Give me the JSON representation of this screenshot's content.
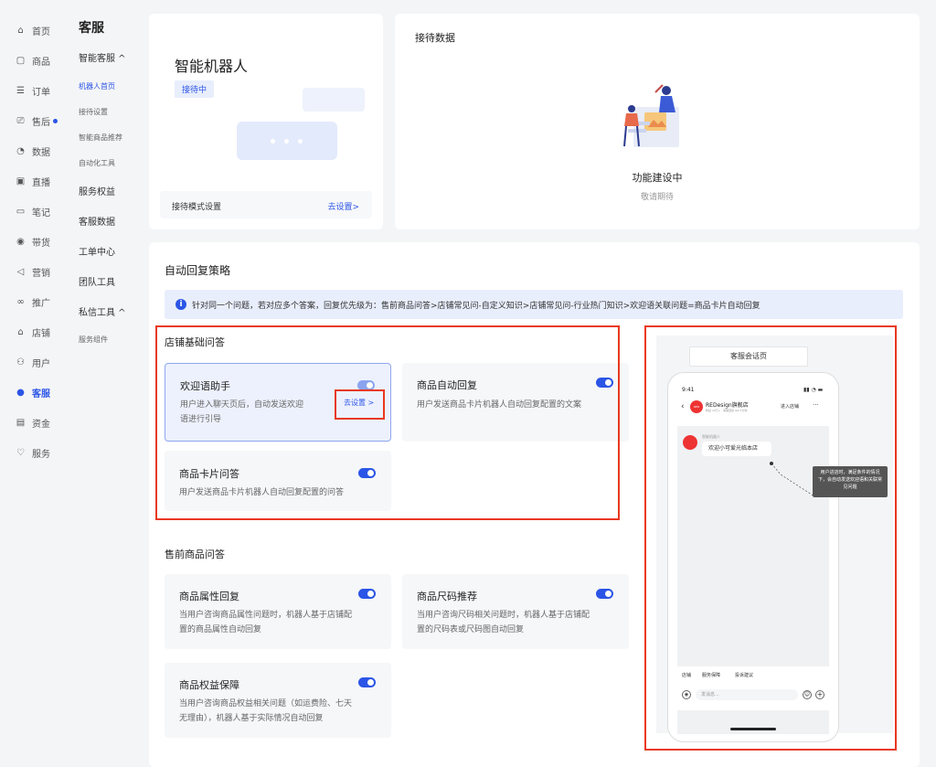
{
  "nav_primary": [
    {
      "label": "首页",
      "icon": "home-icon"
    },
    {
      "label": "商品",
      "icon": "goods-icon"
    },
    {
      "label": "订单",
      "icon": "order-icon"
    },
    {
      "label": "售后",
      "icon": "after-sale-icon"
    },
    {
      "label": "数据",
      "icon": "data-icon"
    },
    {
      "label": "直播",
      "icon": "live-icon"
    },
    {
      "label": "笔记",
      "icon": "note-icon"
    },
    {
      "label": "带货",
      "icon": "promote-icon"
    },
    {
      "label": "营销",
      "icon": "marketing-icon"
    },
    {
      "label": "推广",
      "icon": "ads-icon"
    },
    {
      "label": "店铺",
      "icon": "shop-icon"
    },
    {
      "label": "用户",
      "icon": "user-icon"
    },
    {
      "label": "客服",
      "icon": "service-icon"
    },
    {
      "label": "资金",
      "icon": "fund-icon"
    },
    {
      "label": "服务",
      "icon": "badge-icon"
    }
  ],
  "nav_secondary": {
    "title": "客服",
    "group1": "智能客服 ^",
    "sub1": [
      "机器人首页",
      "接待设置",
      "智能商品推荐",
      "自动化工具"
    ],
    "g2": "服务权益",
    "g3": "客服数据",
    "g4": "工单中心",
    "g5": "团队工具",
    "g6": "私信工具 ^",
    "sub6": "服务组件"
  },
  "robot": {
    "title": "智能机器人",
    "status": "接待中",
    "mode_label": "接待模式设置",
    "mode_link": "去设置>"
  },
  "reception": {
    "title": "接待数据",
    "building": "功能建设中",
    "expect": "敬请期待"
  },
  "strategy": {
    "title": "自动回复策略",
    "notice": "针对同一个问题，若对应多个答案，回复优先级为：售前商品问答>店铺常见问-自定义知识>店铺常见问-行业热门知识>欢迎语关联问题=商品卡片自动回复",
    "basic_title": "店铺基础问答",
    "presale_title": "售前商品问答",
    "cards": {
      "welcome": {
        "title": "欢迎语助手",
        "desc1": "用户进入聊天页后，自动发送欢迎",
        "desc2": "语进行引导",
        "link": "去设置 >"
      },
      "auto": {
        "title": "商品自动回复",
        "desc1": "用户发送商品卡片机器人自动回复配置的文案"
      },
      "card": {
        "title": "商品卡片问答",
        "desc1": "用户发送商品卡片机器人自动回复配置的问答"
      },
      "attr": {
        "title": "商品属性回复",
        "desc1": "当用户咨询商品属性问题时，机器人基于店铺配",
        "desc2": "置的商品属性自动回复"
      },
      "size": {
        "title": "商品尺码推荐",
        "desc1": "当用户咨询尺码相关问题时，机器人基于店铺配",
        "desc2": "置的尺码表或尺码图自动回复"
      },
      "rights": {
        "title": "商品权益保障",
        "desc1": "当用户咨询商品权益相关问题（如运费险、七天",
        "desc2": "无理由），机器人基于实际情况自动回复"
      }
    }
  },
  "preview": {
    "label": "客服会话页",
    "time": "9:41",
    "shop": "REDesign旗舰店",
    "shop_sub": "粉丝 10万+ · 客服回复 &lt;3分钟",
    "enter": "进入店铺",
    "bot_name": "智能机器人",
    "msg": "欢迎小可爱光临本店",
    "tip": "用户进店时，满足条件的情况下，会自动发送欢迎语和关联常见问题",
    "quick": [
      "店铺",
      "服务保障",
      "投诉建议"
    ],
    "input_placeholder": "发消息..."
  },
  "colors": {
    "accent": "#2b55e6",
    "highlight": "#e8381e"
  }
}
